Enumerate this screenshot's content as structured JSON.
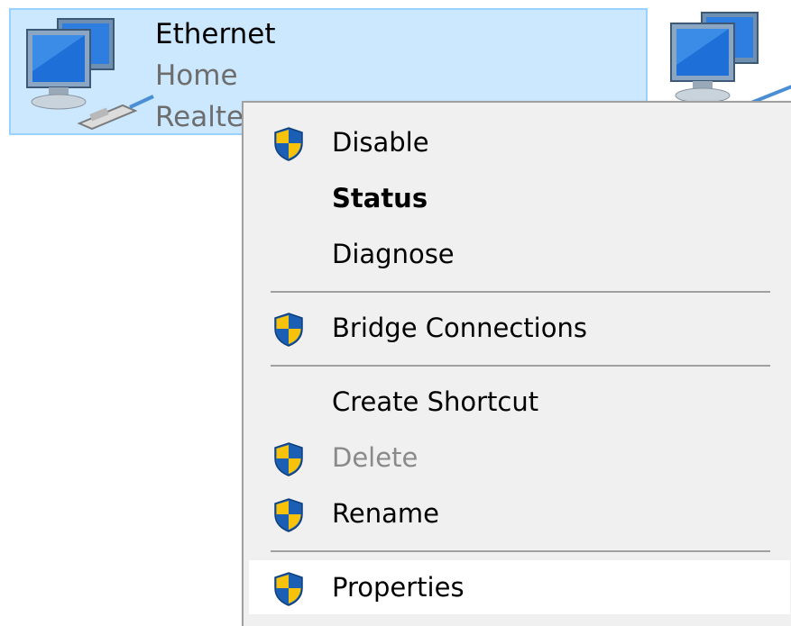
{
  "adapter": {
    "name": "Ethernet",
    "network": "Home",
    "device": "Realtek"
  },
  "context_menu": {
    "items": [
      {
        "label": "Disable",
        "icon": "shield-icon",
        "bold": false,
        "disabled": false
      },
      {
        "label": "Status",
        "icon": null,
        "bold": true,
        "disabled": false
      },
      {
        "label": "Diagnose",
        "icon": null,
        "bold": false,
        "disabled": false
      },
      {
        "label": "Bridge Connections",
        "icon": "shield-icon",
        "bold": false,
        "disabled": false
      },
      {
        "label": "Create Shortcut",
        "icon": null,
        "bold": false,
        "disabled": false
      },
      {
        "label": "Delete",
        "icon": "shield-icon",
        "bold": false,
        "disabled": true
      },
      {
        "label": "Rename",
        "icon": "shield-icon",
        "bold": false,
        "disabled": false
      },
      {
        "label": "Properties",
        "icon": "shield-icon",
        "bold": false,
        "disabled": false,
        "highlighted": true
      }
    ]
  },
  "colors": {
    "selection_background": "#cce8ff",
    "selection_border": "#99d1ff",
    "menu_background": "#f0f0f0",
    "shield_blue": "#1a5fb4",
    "shield_yellow": "#f6c20a"
  }
}
